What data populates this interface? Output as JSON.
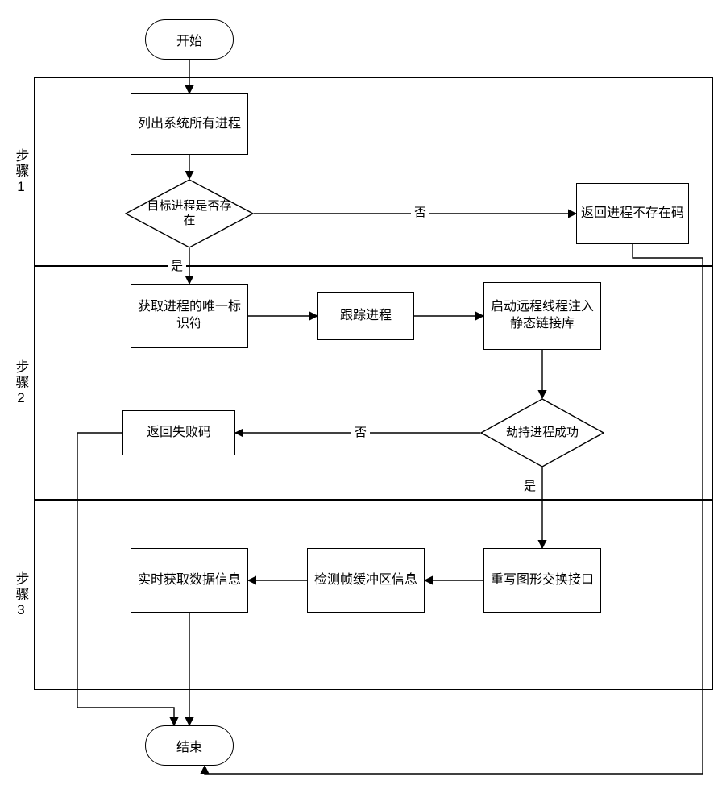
{
  "chart_data": {
    "type": "flowchart",
    "title": "",
    "lanes": [
      "步骤1",
      "步骤2",
      "步骤3"
    ],
    "nodes": {
      "start": {
        "type": "terminator",
        "lane": null,
        "label": "开始"
      },
      "list_proc": {
        "type": "process",
        "lane": "步骤1",
        "label": "列出系统所有进程"
      },
      "target_exists": {
        "type": "decision",
        "lane": "步骤1",
        "label": "目标进程是否存在"
      },
      "no_proc_code": {
        "type": "process",
        "lane": "步骤1",
        "label": "返回进程不存在码"
      },
      "get_uid": {
        "type": "process",
        "lane": "步骤2",
        "label": "获取进程的唯一标识符"
      },
      "trace_proc": {
        "type": "process",
        "lane": "步骤2",
        "label": "跟踪进程"
      },
      "inject_lib": {
        "type": "process",
        "lane": "步骤2",
        "label": "启动远程线程注入静态链接库"
      },
      "hijack_ok": {
        "type": "decision",
        "lane": "步骤2",
        "label": "劫持进程成功"
      },
      "fail_code": {
        "type": "process",
        "lane": "步骤2",
        "label": "返回失败码"
      },
      "rewrite_gfx": {
        "type": "process",
        "lane": "步骤3",
        "label": "重写图形交换接口"
      },
      "check_fb": {
        "type": "process",
        "lane": "步骤3",
        "label": "检测帧缓冲区信息"
      },
      "get_data": {
        "type": "process",
        "lane": "步骤3",
        "label": "实时获取数据信息"
      },
      "end": {
        "type": "terminator",
        "lane": null,
        "label": "结束"
      }
    },
    "edges": [
      {
        "from": "start",
        "to": "list_proc",
        "label": ""
      },
      {
        "from": "list_proc",
        "to": "target_exists",
        "label": ""
      },
      {
        "from": "target_exists",
        "to": "no_proc_code",
        "label": "否"
      },
      {
        "from": "target_exists",
        "to": "get_uid",
        "label": "是"
      },
      {
        "from": "get_uid",
        "to": "trace_proc",
        "label": ""
      },
      {
        "from": "trace_proc",
        "to": "inject_lib",
        "label": ""
      },
      {
        "from": "inject_lib",
        "to": "hijack_ok",
        "label": ""
      },
      {
        "from": "hijack_ok",
        "to": "fail_code",
        "label": "否"
      },
      {
        "from": "hijack_ok",
        "to": "rewrite_gfx",
        "label": "是"
      },
      {
        "from": "rewrite_gfx",
        "to": "check_fb",
        "label": ""
      },
      {
        "from": "check_fb",
        "to": "get_data",
        "label": ""
      },
      {
        "from": "get_data",
        "to": "end",
        "label": ""
      },
      {
        "from": "fail_code",
        "to": "end",
        "label": ""
      },
      {
        "from": "no_proc_code",
        "to": "end",
        "label": ""
      }
    ]
  },
  "labels": {
    "start": "开始",
    "end": "结束",
    "lane1": "步骤1",
    "lane2": "步骤2",
    "lane3": "步骤3",
    "list_proc": "列出系统所有进程",
    "target_exists": "目标进程是否存在",
    "no_proc_code": "返回进程不存在码",
    "get_uid": "获取进程的唯一标识符",
    "trace_proc": "跟踪进程",
    "inject_lib": "启动远程线程注入静态链接库",
    "hijack_ok": "劫持进程成功",
    "fail_code": "返回失败码",
    "rewrite_gfx": "重写图形交换接口",
    "check_fb": "检测帧缓冲区信息",
    "get_data": "实时获取数据信息",
    "edge_no": "否",
    "edge_yes": "是"
  }
}
